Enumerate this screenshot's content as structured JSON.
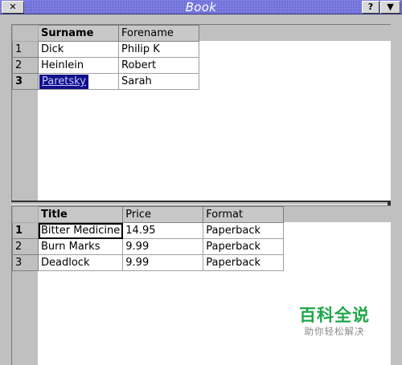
{
  "window": {
    "title": "Book",
    "close_label": "✕",
    "help_label": "?",
    "menu_label": "▼"
  },
  "authors": {
    "columns": [
      "Surname",
      "Forename"
    ],
    "rows": [
      {
        "num": "1",
        "surname": "Dick",
        "forename": "Philip K"
      },
      {
        "num": "2",
        "surname": "Heinlein",
        "forename": "Robert"
      },
      {
        "num": "3",
        "surname": "Paretsky",
        "forename": "Sarah"
      }
    ],
    "selected_row": "3"
  },
  "books": {
    "columns": [
      "Title",
      "Price",
      "Format"
    ],
    "rows": [
      {
        "num": "1",
        "title": "Bitter Medicine",
        "price": "14.95",
        "format": "Paperback"
      },
      {
        "num": "2",
        "title": "Burn Marks",
        "price": "9.99",
        "format": "Paperback"
      },
      {
        "num": "3",
        "title": "Deadlock",
        "price": "9.99",
        "format": "Paperback"
      }
    ],
    "current_row": "1"
  },
  "watermark": {
    "main": "百科全说",
    "sub": "助你轻松解决"
  }
}
